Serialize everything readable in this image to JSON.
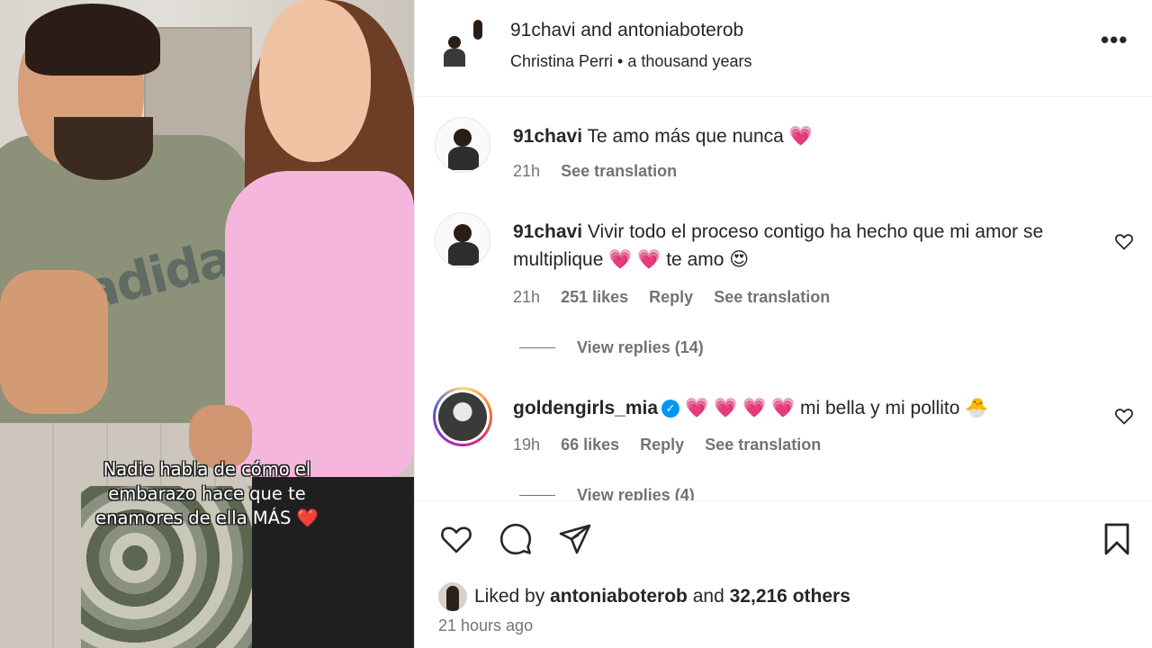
{
  "media": {
    "caption_line1": "Nadie habla de cómo el",
    "caption_line2": "embarazo hace que te",
    "caption_line3": "enamores de ella MÁS",
    "caption_emoji": "❤️",
    "shirt_logo": "adidas"
  },
  "header": {
    "title": "91chavi and antoniaboterob",
    "audio_artist": "Christina Perri",
    "audio_separator": "•",
    "audio_track": "a thousand years",
    "more_icon": "more-options-icon"
  },
  "comments": [
    {
      "username": "91chavi",
      "text": "Te amo más que nunca",
      "emoji_tail": "💗",
      "time": "21h",
      "see_translation": "See translation"
    },
    {
      "username": "91chavi",
      "text": "Vivir todo el proceso contigo ha hecho que mi amor se multiplique",
      "emoji_mid": "💗 💗",
      "text_tail": "te amo",
      "emoji_tail": "😍",
      "time": "21h",
      "likes": "251 likes",
      "reply": "Reply",
      "see_translation": "See translation",
      "view_replies": "View replies (14)"
    },
    {
      "username": "goldengirls_mia",
      "verified": true,
      "emoji_lead": "💗 💗 💗 💗",
      "text": "mi bella y mi pollito",
      "emoji_tail": "🐣",
      "time": "19h",
      "likes": "66 likes",
      "reply": "Reply",
      "see_translation": "See translation",
      "view_replies": "View replies (4)"
    }
  ],
  "footer": {
    "liked_prefix": "Liked by",
    "liked_user": "antoniaboterob",
    "liked_and": "and",
    "liked_others": "32,216 others",
    "timestamp": "21 hours ago"
  },
  "colors": {
    "accent_heart": "#f0325b",
    "verified_blue": "#0095f6",
    "text_primary": "#262626",
    "text_secondary": "#737373"
  }
}
